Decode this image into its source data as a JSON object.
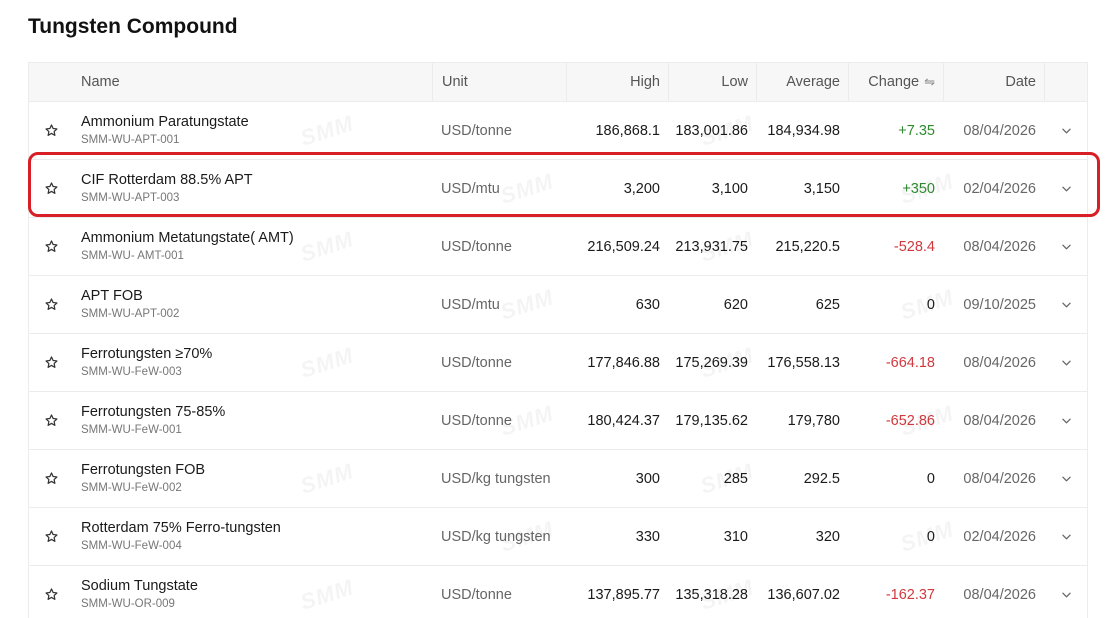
{
  "page": {
    "title": "Tungsten Compound"
  },
  "table": {
    "columns": {
      "name": "Name",
      "unit": "Unit",
      "high": "High",
      "low": "Low",
      "average": "Average",
      "change": "Change",
      "date": "Date"
    },
    "rows": [
      {
        "name": "Ammonium Paratungstate",
        "code": "SMM-WU-APT-001",
        "unit": "USD/tonne",
        "high": "186,868.1",
        "low": "183,001.86",
        "average": "184,934.98",
        "change": "+7.35",
        "change_dir": "pos",
        "date": "08/04/2026"
      },
      {
        "name": "CIF Rotterdam 88.5% APT",
        "code": "SMM-WU-APT-003",
        "unit": "USD/mtu",
        "high": "3,200",
        "low": "3,100",
        "average": "3,150",
        "change": "+350",
        "change_dir": "pos",
        "date": "02/04/2026"
      },
      {
        "name": "Ammonium Metatungstate( AMT)",
        "code": "SMM-WU- AMT-001",
        "unit": "USD/tonne",
        "high": "216,509.24",
        "low": "213,931.75",
        "average": "215,220.5",
        "change": "-528.4",
        "change_dir": "neg",
        "date": "08/04/2026"
      },
      {
        "name": "APT FOB",
        "code": "SMM-WU-APT-002",
        "unit": "USD/mtu",
        "high": "630",
        "low": "620",
        "average": "625",
        "change": "0",
        "change_dir": "zero",
        "date": "09/10/2025"
      },
      {
        "name": "Ferrotungsten ≥70%",
        "code": "SMM-WU-FeW-003",
        "unit": "USD/tonne",
        "high": "177,846.88",
        "low": "175,269.39",
        "average": "176,558.13",
        "change": "-664.18",
        "change_dir": "neg",
        "date": "08/04/2026"
      },
      {
        "name": "Ferrotungsten 75-85%",
        "code": "SMM-WU-FeW-001",
        "unit": "USD/tonne",
        "high": "180,424.37",
        "low": "179,135.62",
        "average": "179,780",
        "change": "-652.86",
        "change_dir": "neg",
        "date": "08/04/2026"
      },
      {
        "name": "Ferrotungsten FOB",
        "code": "SMM-WU-FeW-002",
        "unit": "USD/kg tungsten",
        "high": "300",
        "low": "285",
        "average": "292.5",
        "change": "0",
        "change_dir": "zero",
        "date": "08/04/2026"
      },
      {
        "name": "Rotterdam 75% Ferro-tungsten",
        "code": "SMM-WU-FeW-004",
        "unit": "USD/kg tungsten",
        "high": "330",
        "low": "310",
        "average": "320",
        "change": "0",
        "change_dir": "zero",
        "date": "02/04/2026"
      },
      {
        "name": "Sodium Tungstate",
        "code": "SMM-WU-OR-009",
        "unit": "USD/tonne",
        "high": "137,895.77",
        "low": "135,318.28",
        "average": "136,607.02",
        "change": "-162.37",
        "change_dir": "neg",
        "date": "08/04/2026"
      }
    ]
  },
  "watermark": {
    "text": "SMM"
  },
  "icons": {
    "favorite": "star-icon",
    "expand": "chevron-down-icon",
    "sort": "swap-arrows-icon"
  },
  "colors": {
    "positive": "#2e8b2e",
    "negative": "#d0393e",
    "highlight": "#d81f26"
  }
}
